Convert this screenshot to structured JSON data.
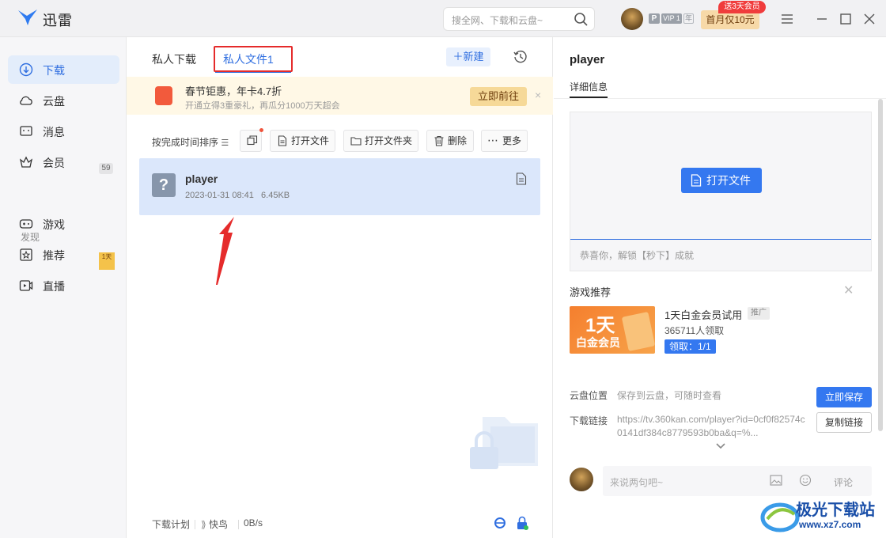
{
  "app": {
    "title": "迅雷"
  },
  "search": {
    "placeholder": "搜全网、下载和云盘~"
  },
  "user": {
    "vip_p": "P",
    "vip_level": "VIP 1",
    "vip_year": "年",
    "promo": "首月仅10元",
    "promo_tag": "送3天会员"
  },
  "sidebar": {
    "items": [
      {
        "label": "下载",
        "icon": "download-icon"
      },
      {
        "label": "云盘",
        "icon": "cloud-icon"
      },
      {
        "label": "消息",
        "icon": "message-icon",
        "badge": "59"
      },
      {
        "label": "会员",
        "icon": "crown-icon"
      }
    ],
    "section": "发现",
    "discover": [
      {
        "label": "游戏",
        "icon": "gamepad-icon",
        "thumb": "1天"
      },
      {
        "label": "推荐",
        "icon": "star-icon"
      },
      {
        "label": "直播",
        "icon": "live-icon"
      }
    ]
  },
  "middle": {
    "tabs": [
      "私人下载",
      "私人文件1"
    ],
    "new_label": "新建",
    "banner": {
      "title": "春节钜惠，年卡4.7折",
      "sub": "开通立得3重豪礼，再瓜分1000万天超会",
      "button": "立即前往",
      "close": "×"
    },
    "sort_label": "按完成时间排序",
    "toolbar": [
      "打开文件",
      "打开文件夹",
      "删除",
      "更多"
    ],
    "file": {
      "name": "player",
      "date": "2023-01-31 08:41",
      "size": "6.45KB",
      "icon": "?"
    },
    "footer": {
      "plan": "下载计划",
      "bird": "快鸟",
      "speed": "0B/s"
    }
  },
  "right": {
    "title": "player",
    "tab": "详细信息",
    "open_button": "打开文件",
    "hint": "恭喜你，解锁【秒下】成就",
    "game_section": "游戏推荐",
    "game": {
      "img_big": "1天",
      "img_small": "白金会员",
      "name": "1天白金会员试用",
      "ad": "推广",
      "count": "365711人领取",
      "claim": "领取：1/1"
    },
    "cloud_label": "云盘位置",
    "cloud_value": "保存到云盘，可随时查看",
    "save_button": "立即保存",
    "link_label": "下载链接",
    "link_value": "https://tv.360kan.com/player?id=0cf0f82574c0141df384c8779593b0ba&q=%...",
    "copy_link": "复制链接",
    "comment_placeholder": "来说两句吧~",
    "comment_send": "评论"
  },
  "watermark": {
    "line1": "极光下载站",
    "line2": "www.xz7.com"
  },
  "colors": {
    "accent": "#2f6ee0",
    "button": "#3478f0",
    "highlight_box": "#e52b2b",
    "selected_row": "#dbe7fb"
  }
}
